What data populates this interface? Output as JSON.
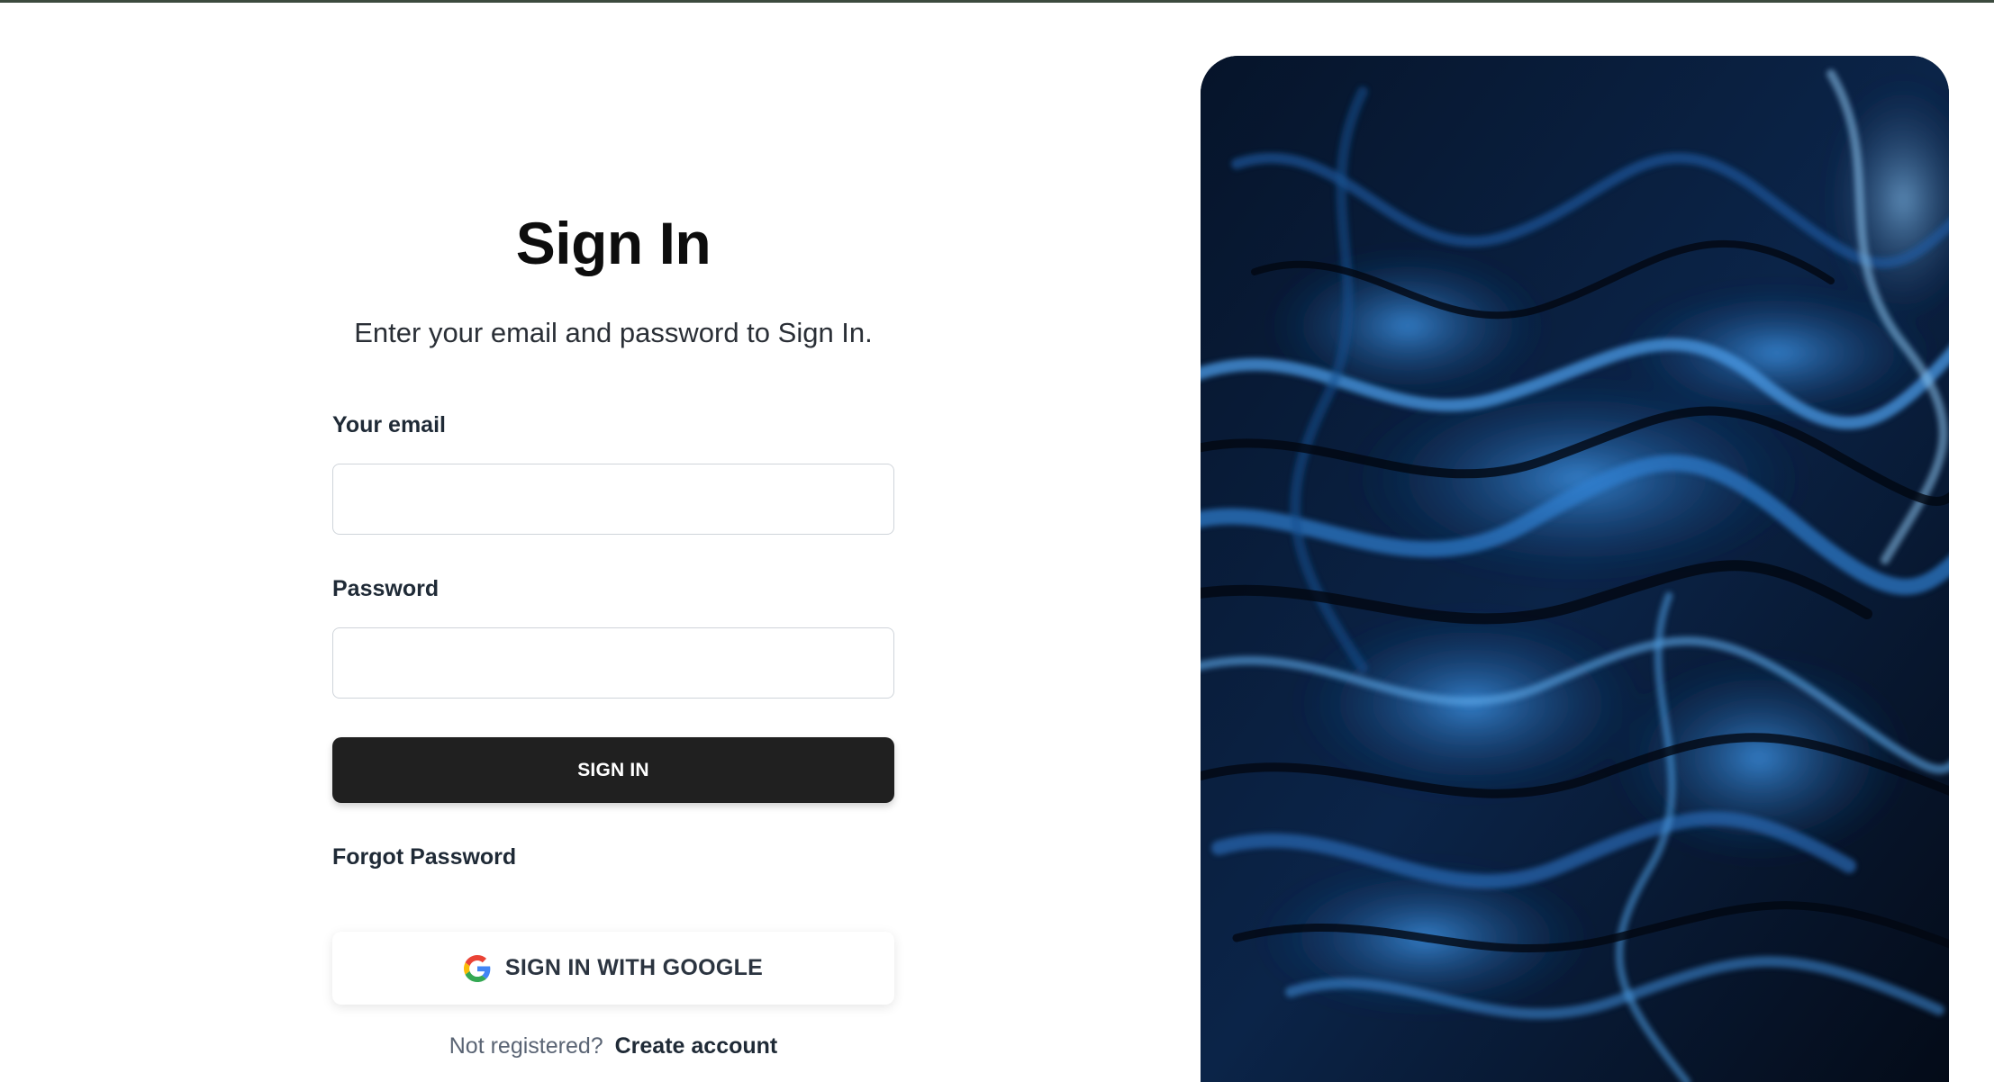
{
  "auth": {
    "title": "Sign In",
    "subtitle": "Enter your email and password to Sign In.",
    "email_label": "Your email",
    "email_value": "",
    "password_label": "Password",
    "password_value": "",
    "sign_in_label": "SIGN IN",
    "forgot_label": "Forgot Password",
    "google_label": "SIGN IN WITH GOOGLE",
    "footer_prompt": "Not registered?",
    "footer_link": "Create account"
  },
  "colors": {
    "primary_button": "#202020",
    "top_bar": "#3c4a3e",
    "image_base": "#040d1c",
    "image_accent": "#1f6fc4"
  },
  "icons": {
    "google": "google-g-icon"
  }
}
